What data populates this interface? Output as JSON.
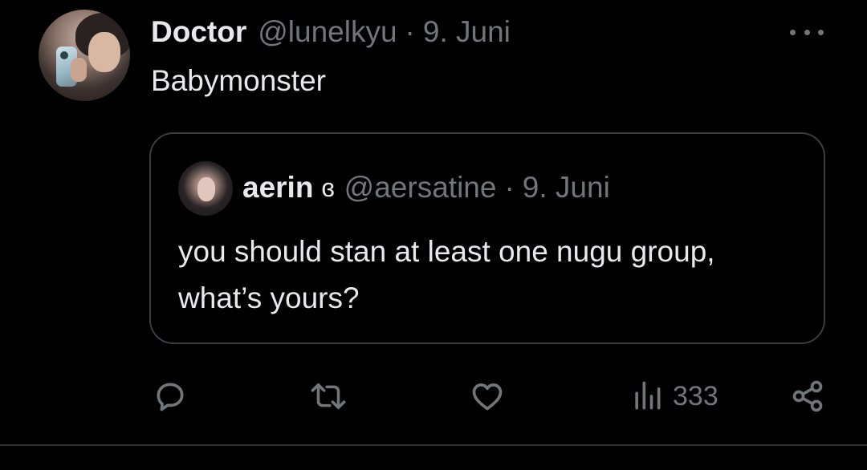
{
  "tweet": {
    "author_name": "Doctor",
    "author_handle": "@lunelkyu",
    "separator": "·",
    "date": "9. Juni",
    "text": "Babymonster",
    "avatar_icon": "avatar-photo",
    "more_icon": "more-icon"
  },
  "quote": {
    "author_name": "aerin",
    "author_emoji": "ɞ",
    "author_handle": "@aersatine",
    "separator": "·",
    "date": "9. Juni",
    "text": "you should stan at least one nugu group, what’s yours?"
  },
  "actions": {
    "reply_icon": "reply-icon",
    "retweet_icon": "retweet-icon",
    "like_icon": "heart-icon",
    "views_icon": "views-icon",
    "views_count": "333",
    "share_icon": "share-icon"
  },
  "colors": {
    "background": "#000000",
    "text": "#e7e9ea",
    "secondary": "#71767b",
    "border": "#3a3d40"
  }
}
